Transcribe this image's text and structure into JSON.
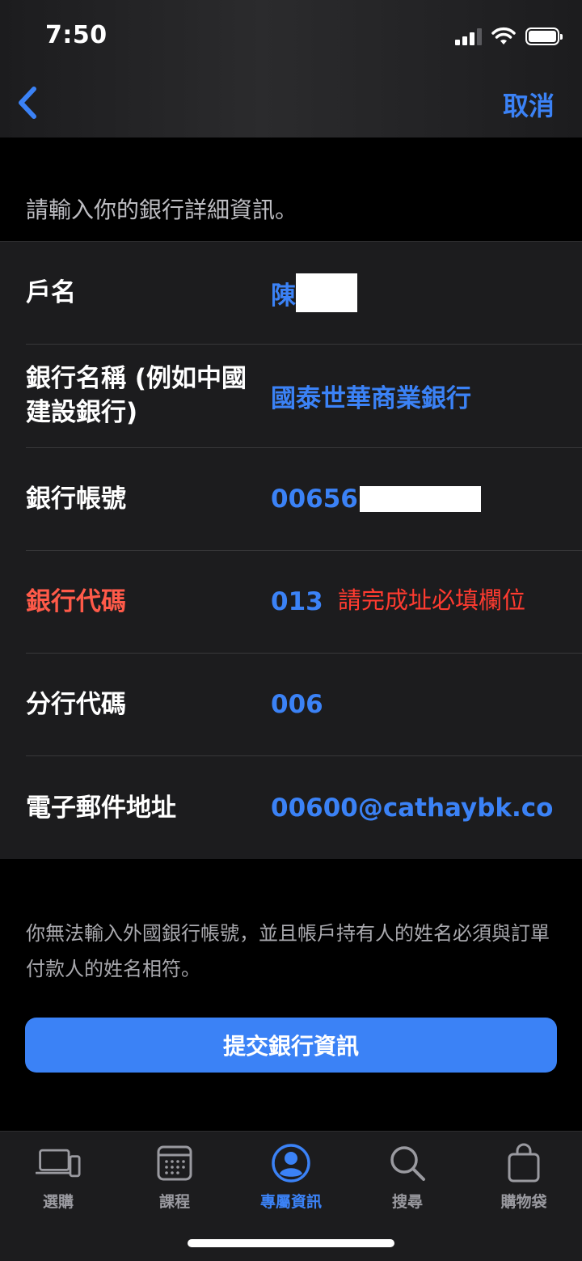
{
  "status": {
    "time": "7:50"
  },
  "nav": {
    "cancel_label": "取消"
  },
  "prompt": "請輸入你的銀行詳細資訊。",
  "form": {
    "rows": [
      {
        "label": "戶名",
        "value": "陳",
        "error": false
      },
      {
        "label": "銀行名稱 (例如中國建設銀行)",
        "value": "國泰世華商業銀行",
        "error": false
      },
      {
        "label": "銀行帳號",
        "value": "00656",
        "error": false
      },
      {
        "label": "銀行代碼",
        "value": "013",
        "error": true
      },
      {
        "label": "分行代碼",
        "value": "006",
        "error": false
      },
      {
        "label": "電子郵件地址",
        "value": "00600@cathaybk.co...",
        "error": false
      }
    ],
    "error_note": "請完成址必填欄位"
  },
  "disclaimer": "你無法輸入外國銀行帳號，並且帳戶持有人的姓名必須與訂單付款人的姓名相符。",
  "submit_label": "提交銀行資訊",
  "tabs": [
    {
      "label": "選購",
      "icon": "laptop-phone-icon",
      "active": false
    },
    {
      "label": "課程",
      "icon": "calendar-grid-icon",
      "active": false
    },
    {
      "label": "專屬資訊",
      "icon": "person-circle-icon",
      "active": true
    },
    {
      "label": "搜尋",
      "icon": "search-icon",
      "active": false
    },
    {
      "label": "購物袋",
      "icon": "shopping-bag-icon",
      "active": false
    }
  ],
  "colors": {
    "accent": "#3b82f6",
    "error": "#ff5a49",
    "background": "#000000",
    "panel": "#1c1c1e"
  }
}
